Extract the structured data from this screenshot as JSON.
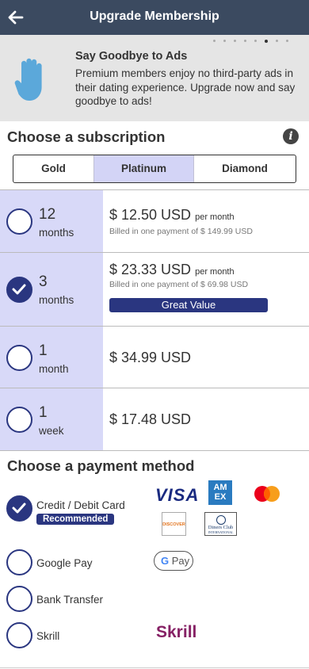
{
  "header": {
    "title": "Upgrade Membership",
    "back_icon": "arrow-left-icon"
  },
  "banner": {
    "title": "Say Goodbye to Ads",
    "description": "Premium members enjoy no third-party ads in their dating experience. Upgrade now and say goodbye to ads!",
    "icon": "raised-hand-icon",
    "carousel": {
      "total": 8,
      "active": 5
    }
  },
  "subscription": {
    "heading": "Choose a subscription",
    "tabs": [
      "Gold",
      "Platinum",
      "Diamond"
    ],
    "selected_tab": "Platinum",
    "plans": [
      {
        "num": "12",
        "unit": "months",
        "price": "$ 12.50 USD",
        "per": "per month",
        "billed": "Billed in one payment of $ 149.99 USD",
        "selected": false
      },
      {
        "num": "3",
        "unit": "months",
        "price": "$ 23.33 USD",
        "per": "per month",
        "billed": "Billed in one payment of $ 69.98 USD",
        "badge": "Great Value",
        "selected": true
      },
      {
        "num": "1",
        "unit": "month",
        "price": "$ 34.99 USD",
        "selected": false
      },
      {
        "num": "1",
        "unit": "week",
        "price": "$ 17.48 USD",
        "selected": false
      }
    ]
  },
  "payment": {
    "heading": "Choose a payment method",
    "methods": [
      {
        "label": "Credit / Debit Card",
        "badge": "Recommended",
        "selected": true
      },
      {
        "label": "Google Pay",
        "selected": false
      },
      {
        "label": "Bank Transfer",
        "selected": false
      },
      {
        "label": "Skrill",
        "selected": false
      }
    ],
    "logos": {
      "visa": "VISA",
      "amex_line1": "AM",
      "amex_line2": "EX",
      "discover": "DISCOVER",
      "diners_line1": "Diners Club",
      "diners_line2": "INTERNATIONAL",
      "gpay": "Pay",
      "skrill": "Skrill"
    }
  },
  "colors": {
    "header": "#3b4a60",
    "accent": "#2a3680",
    "plan_bg": "#d8d9f8"
  }
}
